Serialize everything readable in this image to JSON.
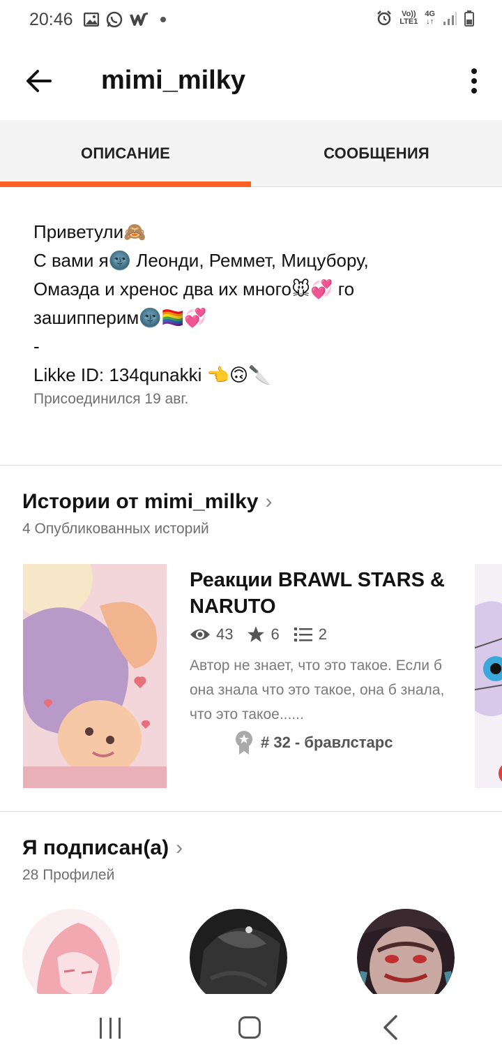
{
  "status_bar": {
    "time": "20:46",
    "left_icons": [
      "gallery-icon",
      "whatsapp-icon",
      "wattpad-icon",
      "dot-icon"
    ],
    "right_icons": [
      "alarm-icon",
      "volte-icon",
      "4g-icon",
      "signal-icon",
      "battery-icon"
    ],
    "volte_top": "Vo))",
    "volte_bottom": "LTE1",
    "net_type": "4G"
  },
  "app_bar": {
    "title": "mimi_milky",
    "back_icon": "arrow-left-icon",
    "menu_icon": "more-vertical-icon"
  },
  "tabs": [
    {
      "label": "ОПИСАНИЕ",
      "active": true
    },
    {
      "label": "СООБЩЕНИЯ",
      "active": false
    }
  ],
  "accent_color": "#ff6122",
  "description": {
    "lines": [
      "Приветули🙈",
      "С вами я🌚 Леонди, Реммет, Мицубору,",
      "Омаэда и хренос два их много🐭💞 го",
      "зашипперим🌚🏳️‍🌈💞",
      "-",
      "Likke ID: 134qunakki 👈🙃🔪"
    ],
    "joined": "Присоединился 19 авг."
  },
  "stories_section": {
    "title": "Истории от mimi_milky",
    "subtitle": "4 Опубликованных историй",
    "story": {
      "title": "Реакции BRAWL STARS & NARUTO",
      "views": "43",
      "votes": "6",
      "parts": "2",
      "description": "Автор не знает, что это такое. Если б она знала что это такое, она б знала, что это такое......",
      "rank": "# 32 - бравлстарс"
    }
  },
  "following_section": {
    "title": "Я подписан(а)",
    "subtitle": "28 Профилей"
  }
}
